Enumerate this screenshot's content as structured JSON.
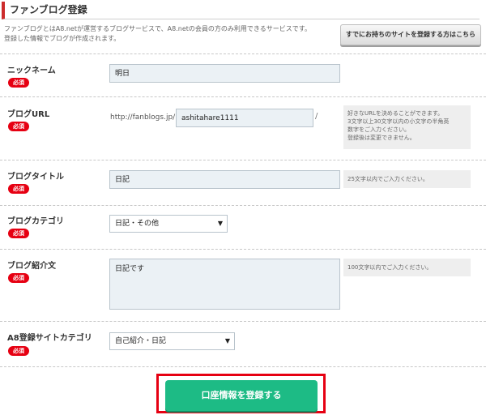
{
  "page": {
    "title": "ファンブログ登録",
    "intro_line1": "ファンブログとはA8.netが運営するブログサービスで、A8.netの会員の方のみ利用できるサービスです。",
    "intro_line2": "登録した情報でブログが作成されます。",
    "existing_site_button": "すでにお持ちのサイトを登録する方はこちら"
  },
  "required_badge": "必須",
  "form": {
    "nickname": {
      "label": "ニックネーム",
      "value": "明日"
    },
    "blog_url": {
      "label": "ブログURL",
      "prefix": "http://fanblogs.jp/",
      "value": "ashitahare1111",
      "suffix": "/",
      "hint1": "好きなURLを決めることができます。",
      "hint2": "3文字以上30文字以内の小文字の半角英",
      "hint3": "数字をご入力ください。",
      "hint4": "登録後は変更できません。"
    },
    "blog_title": {
      "label": "ブログタイトル",
      "value": "日記",
      "hint": "25文字以内でご入力ください。"
    },
    "blog_category": {
      "label": "ブログカテゴリ",
      "selected": "日記・その他"
    },
    "blog_intro": {
      "label": "ブログ紹介文",
      "value": "日記です",
      "hint": "100文字以内でご入力ください。"
    },
    "a8_category": {
      "label": "A8登録サイトカテゴリ",
      "selected": "自己紹介・日記"
    }
  },
  "submit_button": "口座情報を登録する",
  "colors": {
    "accent_red": "#e60012",
    "submit_green": "#1dbb85"
  }
}
